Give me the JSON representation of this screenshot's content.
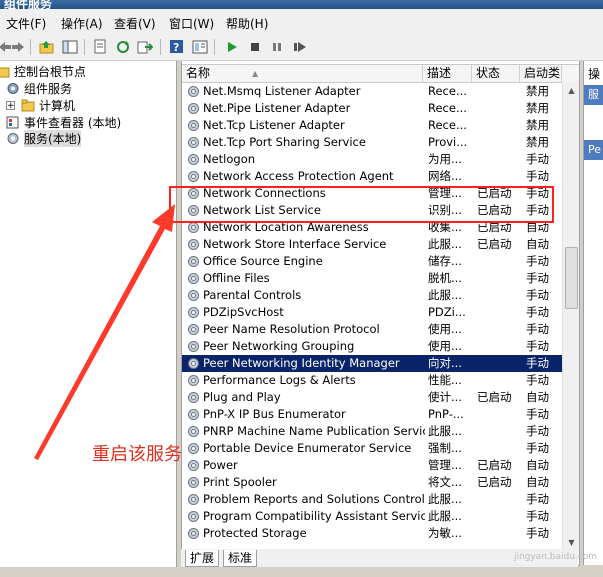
{
  "window": {
    "title": "组件服务"
  },
  "menu": [
    "文件(F)",
    "操作(A)",
    "查看(V)",
    "窗口(W)",
    "帮助(H)"
  ],
  "toolbar_icons": [
    "back-arrow-icon",
    "forward-arrow-icon",
    "folder-up-icon",
    "show-tree-icon",
    "properties-icon",
    "refresh-icon",
    "export-icon",
    "help-icon",
    "view-icon",
    "start-icon",
    "stop-icon",
    "pause-icon",
    "restart-icon"
  ],
  "tree": {
    "root": "控制台根节点",
    "items": [
      {
        "label": "组件服务"
      },
      {
        "label": "计算机"
      },
      {
        "label": "事件查看器 (本地)"
      },
      {
        "label": "服务(本地)"
      }
    ]
  },
  "columns": {
    "name": "名称",
    "desc": "描述",
    "status": "状态",
    "startup": "启动类"
  },
  "services": [
    {
      "name": "Net.Msmq Listener Adapter",
      "desc": "Rece...",
      "status": "",
      "startup": "禁用"
    },
    {
      "name": "Net.Pipe Listener Adapter",
      "desc": "Rece...",
      "status": "",
      "startup": "禁用"
    },
    {
      "name": "Net.Tcp Listener Adapter",
      "desc": "Rece...",
      "status": "",
      "startup": "禁用"
    },
    {
      "name": "Net.Tcp Port Sharing Service",
      "desc": "Provi...",
      "status": "",
      "startup": "禁用"
    },
    {
      "name": "Netlogon",
      "desc": "为用...",
      "status": "",
      "startup": "手动"
    },
    {
      "name": "Network Access Protection Agent",
      "desc": "网络...",
      "status": "",
      "startup": "手动"
    },
    {
      "name": "Network Connections",
      "desc": "管理...",
      "status": "已启动",
      "startup": "手动"
    },
    {
      "name": "Network List Service",
      "desc": "识别...",
      "status": "已启动",
      "startup": "手动"
    },
    {
      "name": "Network Location Awareness",
      "desc": "收集...",
      "status": "已启动",
      "startup": "自动"
    },
    {
      "name": "Network Store Interface Service",
      "desc": "此服...",
      "status": "已启动",
      "startup": "自动"
    },
    {
      "name": "Office  Source Engine",
      "desc": "储存...",
      "status": "",
      "startup": "手动"
    },
    {
      "name": "Offline Files",
      "desc": "脱机...",
      "status": "",
      "startup": "手动"
    },
    {
      "name": "Parental Controls",
      "desc": "此服...",
      "status": "",
      "startup": "手动"
    },
    {
      "name": "PDZipSvcHost",
      "desc": "PDZi...",
      "status": "",
      "startup": "手动"
    },
    {
      "name": "Peer Name Resolution Protocol",
      "desc": "使用...",
      "status": "",
      "startup": "手动"
    },
    {
      "name": "Peer Networking Grouping",
      "desc": "使用...",
      "status": "",
      "startup": "手动"
    },
    {
      "name": "Peer Networking Identity Manager",
      "desc": "向对...",
      "status": "",
      "startup": "手动"
    },
    {
      "name": "Performance Logs & Alerts",
      "desc": "性能...",
      "status": "",
      "startup": "手动"
    },
    {
      "name": "Plug and Play",
      "desc": "使计...",
      "status": "已启动",
      "startup": "自动"
    },
    {
      "name": "PnP-X IP Bus Enumerator",
      "desc": "PnP-...",
      "status": "",
      "startup": "手动"
    },
    {
      "name": "PNRP Machine Name Publication Service",
      "desc": "此服...",
      "status": "",
      "startup": "手动"
    },
    {
      "name": "Portable Device Enumerator Service",
      "desc": "强制...",
      "status": "",
      "startup": "手动"
    },
    {
      "name": "Power",
      "desc": "管理...",
      "status": "已启动",
      "startup": "自动"
    },
    {
      "name": "Print Spooler",
      "desc": "将文...",
      "status": "已启动",
      "startup": "自动"
    },
    {
      "name": "Problem Reports and Solutions Control Pa...",
      "desc": "此服...",
      "status": "",
      "startup": "手动"
    },
    {
      "name": "Program Compatibility Assistant Service",
      "desc": "此服...",
      "status": "",
      "startup": "手动"
    },
    {
      "name": "Protected Storage",
      "desc": "为敏...",
      "status": "",
      "startup": "手动"
    }
  ],
  "selected_index": 16,
  "tabs": [
    "扩展",
    "标准"
  ],
  "right_pane": {
    "header": "操",
    "section1": "服",
    "section2": "Pe"
  },
  "annotation": {
    "text": "重启该服务",
    "color": "#e03020"
  },
  "watermark": "jingyan.baidu.com"
}
